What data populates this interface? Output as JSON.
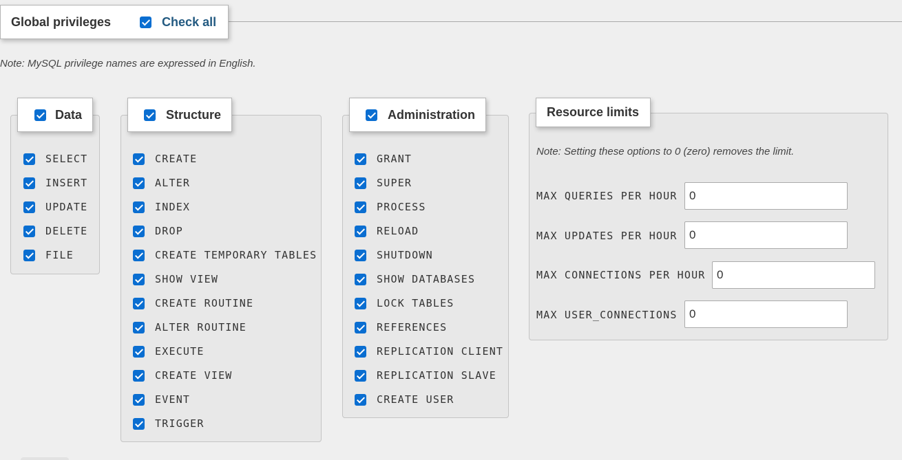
{
  "header": {
    "title": "Global privileges",
    "check_all_label": "Check all"
  },
  "note": "Note: MySQL privilege names are expressed in English.",
  "groups": {
    "data": {
      "title": "Data",
      "items": [
        "SELECT",
        "INSERT",
        "UPDATE",
        "DELETE",
        "FILE"
      ]
    },
    "structure": {
      "title": "Structure",
      "items": [
        "CREATE",
        "ALTER",
        "INDEX",
        "DROP",
        "CREATE TEMPORARY TABLES",
        "SHOW VIEW",
        "CREATE ROUTINE",
        "ALTER ROUTINE",
        "EXECUTE",
        "CREATE VIEW",
        "EVENT",
        "TRIGGER"
      ]
    },
    "administration": {
      "title": "Administration",
      "items": [
        "GRANT",
        "SUPER",
        "PROCESS",
        "RELOAD",
        "SHUTDOWN",
        "SHOW DATABASES",
        "LOCK TABLES",
        "REFERENCES",
        "REPLICATION CLIENT",
        "REPLICATION SLAVE",
        "CREATE USER"
      ]
    }
  },
  "resource_limits": {
    "title": "Resource limits",
    "note": "Note: Setting these options to 0 (zero) removes the limit.",
    "fields": [
      {
        "label": "MAX QUERIES PER HOUR",
        "value": "0"
      },
      {
        "label": "MAX UPDATES PER HOUR",
        "value": "0"
      },
      {
        "label": "MAX CONNECTIONS PER HOUR",
        "value": "0"
      },
      {
        "label": "MAX USER_CONNECTIONS",
        "value": "0"
      }
    ]
  },
  "colors": {
    "checkbox": "#0a6ed1",
    "check_all_text": "#235a81"
  }
}
